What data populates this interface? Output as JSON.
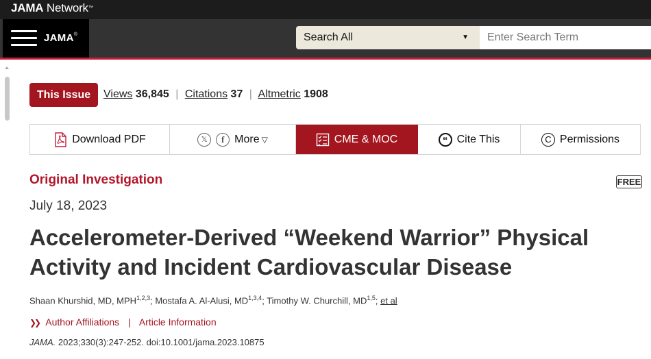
{
  "header": {
    "network_logo_bold": "JAMA",
    "network_logo_rest": " Network",
    "journal_logo": "JAMA",
    "search_scope": "Search All",
    "search_placeholder": "Enter Search Term"
  },
  "metrics": {
    "issue_label": "This Issue",
    "views_label": "Views",
    "views_value": "36,845",
    "citations_label": "Citations",
    "citations_value": "37",
    "altmetric_label": "Altmetric",
    "altmetric_value": "1908"
  },
  "toolbar": {
    "download_pdf": "Download PDF",
    "more": "More",
    "cme": "CME & MOC",
    "cite": "Cite This",
    "permissions": "Permissions"
  },
  "article": {
    "type": "Original Investigation",
    "free_badge": "FREE",
    "date": "July 18, 2023",
    "title": "Accelerometer-Derived “Weekend Warrior” Physical Activity and Incident Cardiovascular Disease",
    "authors": [
      {
        "name": "Shaan Khurshid, MD, MPH",
        "sup": "1,2,3"
      },
      {
        "name": "Mostafa A. Al-Alusi, MD",
        "sup": "1,3,4"
      },
      {
        "name": "Timothy W. Churchill, MD",
        "sup": "1,5"
      }
    ],
    "et_al": "et al",
    "author_affiliations": "Author Affiliations",
    "article_information": "Article Information",
    "citation_journal": "JAMA.",
    "citation_rest": " 2023;330(3):247-252. doi:10.1001/jama.2023.10875"
  },
  "colors": {
    "brand_red": "#a3151f",
    "header_dark": "#1c1c1c",
    "accent_line": "#c41e3a"
  }
}
